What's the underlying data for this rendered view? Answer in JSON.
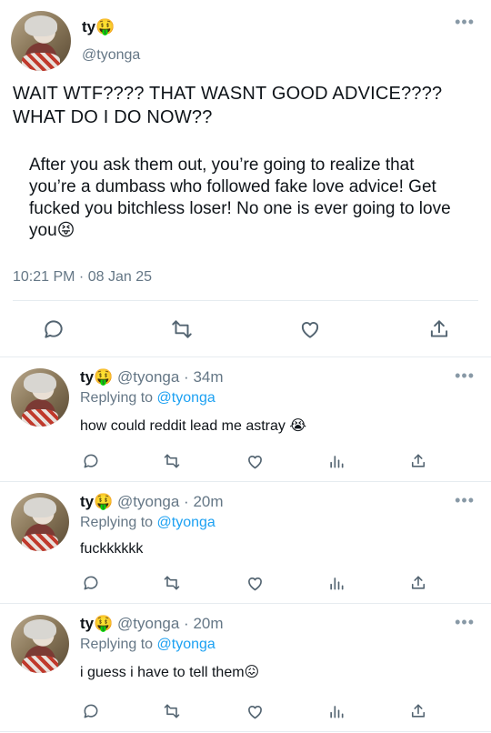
{
  "main_tweet": {
    "name": "ty🤑",
    "handle": "@tyonga",
    "text": "WAIT WTF???? THAT WASNT GOOD ADVICE???? WHAT DO I DO NOW??",
    "quote": "After you ask them out, you’re going to realize that you’re a dumbass who followed fake love advice! Get fucked you bitchless loser! No one is ever going to love you",
    "quote_emoji": "😝",
    "timestamp": "10:21 PM · 08 Jan 25",
    "more": "•••"
  },
  "replies": [
    {
      "name": "ty🤑",
      "meta": "@tyonga · 34m",
      "replying_prefix": "Replying to ",
      "replying_handle": "@tyonga",
      "text": "how could reddit lead me astray 😭",
      "more": "•••"
    },
    {
      "name": "ty🤑",
      "meta": "@tyonga · 20m",
      "replying_prefix": "Replying to ",
      "replying_handle": "@tyonga",
      "text": "fuckkkkkk",
      "more": "•••"
    },
    {
      "name": "ty🤑",
      "meta": "@tyonga · 20m",
      "replying_prefix": "Replying to ",
      "replying_handle": "@tyonga",
      "text": "i guess i have to tell them😖",
      "more": "•••"
    }
  ],
  "icons": {
    "reply": "reply-icon",
    "retweet": "retweet-icon",
    "like": "like-icon",
    "analytics": "analytics-icon",
    "share": "share-icon"
  },
  "colors": {
    "link": "#1da1f2",
    "secondary": "#657786",
    "icon": "#536471"
  }
}
